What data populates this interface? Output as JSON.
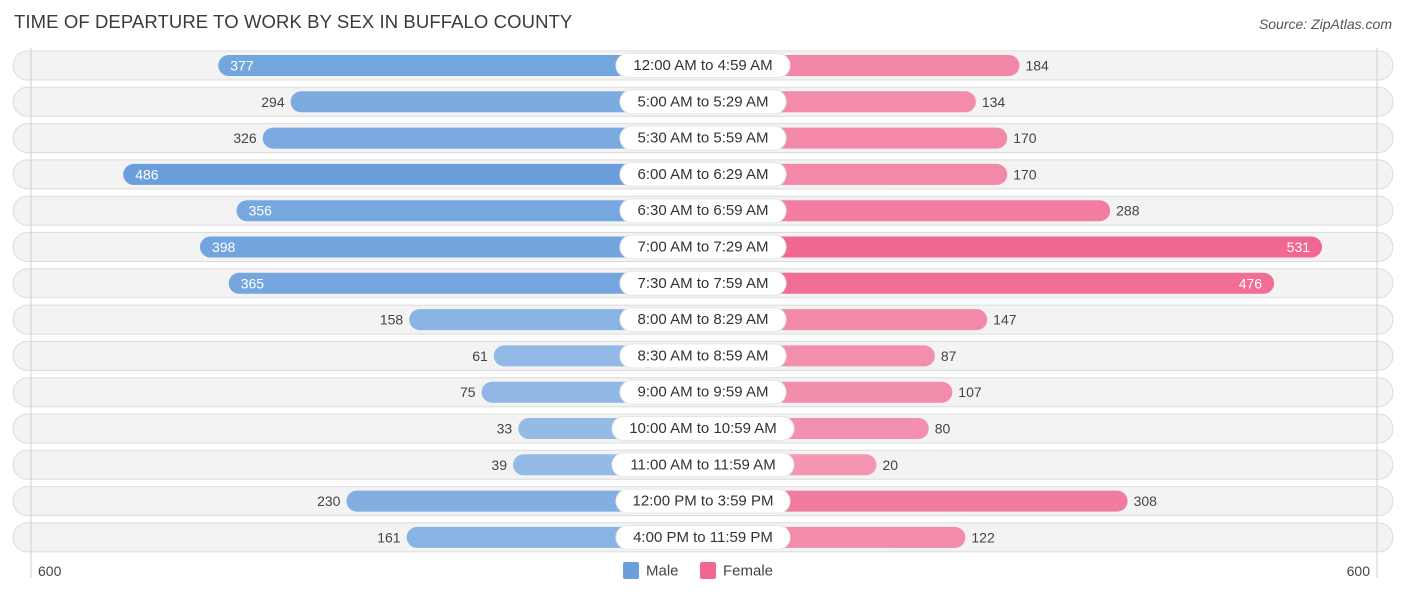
{
  "header": {
    "title": "TIME OF DEPARTURE TO WORK BY SEX IN BUFFALO COUNTY",
    "source": "Source: ZipAtlas.com"
  },
  "colors": {
    "male": "#6a9fdc",
    "male_light": "#a7c6ea",
    "female": "#f06891",
    "female_light": "#f5a6be"
  },
  "chart_data": {
    "type": "bar",
    "orientation": "horizontal-diverging",
    "title": "TIME OF DEPARTURE TO WORK BY SEX IN BUFFALO COUNTY",
    "categories": [
      "12:00 AM to 4:59 AM",
      "5:00 AM to 5:29 AM",
      "5:30 AM to 5:59 AM",
      "6:00 AM to 6:29 AM",
      "6:30 AM to 6:59 AM",
      "7:00 AM to 7:29 AM",
      "7:30 AM to 7:59 AM",
      "8:00 AM to 8:29 AM",
      "8:30 AM to 8:59 AM",
      "9:00 AM to 9:59 AM",
      "10:00 AM to 10:59 AM",
      "11:00 AM to 11:59 AM",
      "12:00 PM to 3:59 PM",
      "4:00 PM to 11:59 PM"
    ],
    "series": [
      {
        "name": "Male",
        "values": [
          377,
          294,
          326,
          486,
          356,
          398,
          365,
          158,
          61,
          75,
          33,
          39,
          230,
          161
        ]
      },
      {
        "name": "Female",
        "values": [
          184,
          134,
          170,
          170,
          288,
          531,
          476,
          147,
          87,
          107,
          80,
          20,
          308,
          122
        ]
      }
    ],
    "axis": {
      "left_tick": "600",
      "right_tick": "600",
      "range": [
        0,
        600
      ]
    },
    "legend": {
      "position": "bottom-center",
      "entries": [
        "Male",
        "Female"
      ]
    },
    "xlabel": "",
    "ylabel": ""
  }
}
